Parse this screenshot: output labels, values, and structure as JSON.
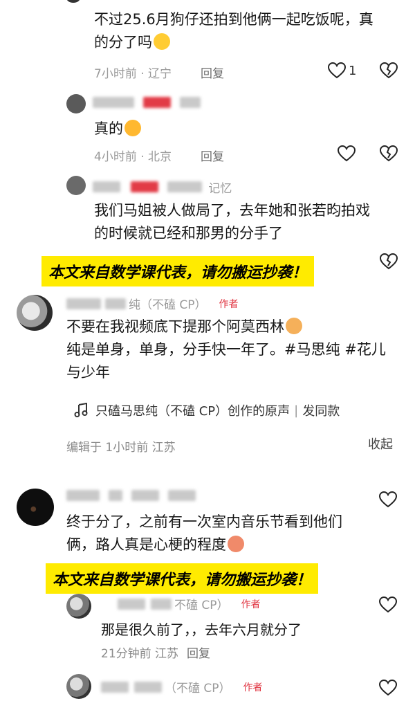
{
  "comments": {
    "c1": {
      "line1": "不过25.6月狗仔还拍到他俩一起吃饭呢，真",
      "line2": "的分了吗",
      "time_loc": "7小时前 · 辽宁",
      "reply_label": "回复",
      "likes": "1"
    },
    "r1": {
      "text": "真的",
      "time_loc": "4小时前 · 北京",
      "reply_label": "回复"
    },
    "c2": {
      "name_tail": "记忆",
      "line1": "我们马姐被人做局了，去年她和张若昀拍戏",
      "line2": "的时候就已经和那男的分手了"
    },
    "author": {
      "name_tail": "纯（不磕 CP）",
      "badge": "作者",
      "line1": "不要在我视频底下提那个阿莫西林",
      "line2": "纯是单身，单身，分手快一年了。#马思纯 #花儿",
      "line3": "与少年",
      "music": "只磕马思纯（不磕 CP）创作的原声",
      "music_sep": "|",
      "music_action": "发同款",
      "edited": "编辑于  1小时前  江苏",
      "collapse": "收起"
    },
    "c3": {
      "line1": "终于分了，之前有一次室内音乐节看到他们",
      "line2": "俩，路人真是心梗的程度"
    },
    "r2": {
      "name_tail": "不磕 CP）",
      "badge": "作者",
      "text": "那是很久前了，，去年六月就分了",
      "time_loc": "21分钟前  江苏",
      "reply_label": "回复"
    },
    "r3": {
      "name_tail": "（不磕 CP）",
      "badge": "作者"
    }
  },
  "banners": {
    "top": "本文来自数学课代表，请勿搬运抄袭！",
    "bottom": "本文来自数学课代表，请勿搬运抄袭！"
  },
  "icons": {
    "like": "heart-outline-icon",
    "dislike": "broken-heart-icon",
    "music": "music-note-icon"
  },
  "colors": {
    "author_badge": "#e0323f",
    "banner_bg": "#ffeb00",
    "blur_red": "#e23b46"
  }
}
